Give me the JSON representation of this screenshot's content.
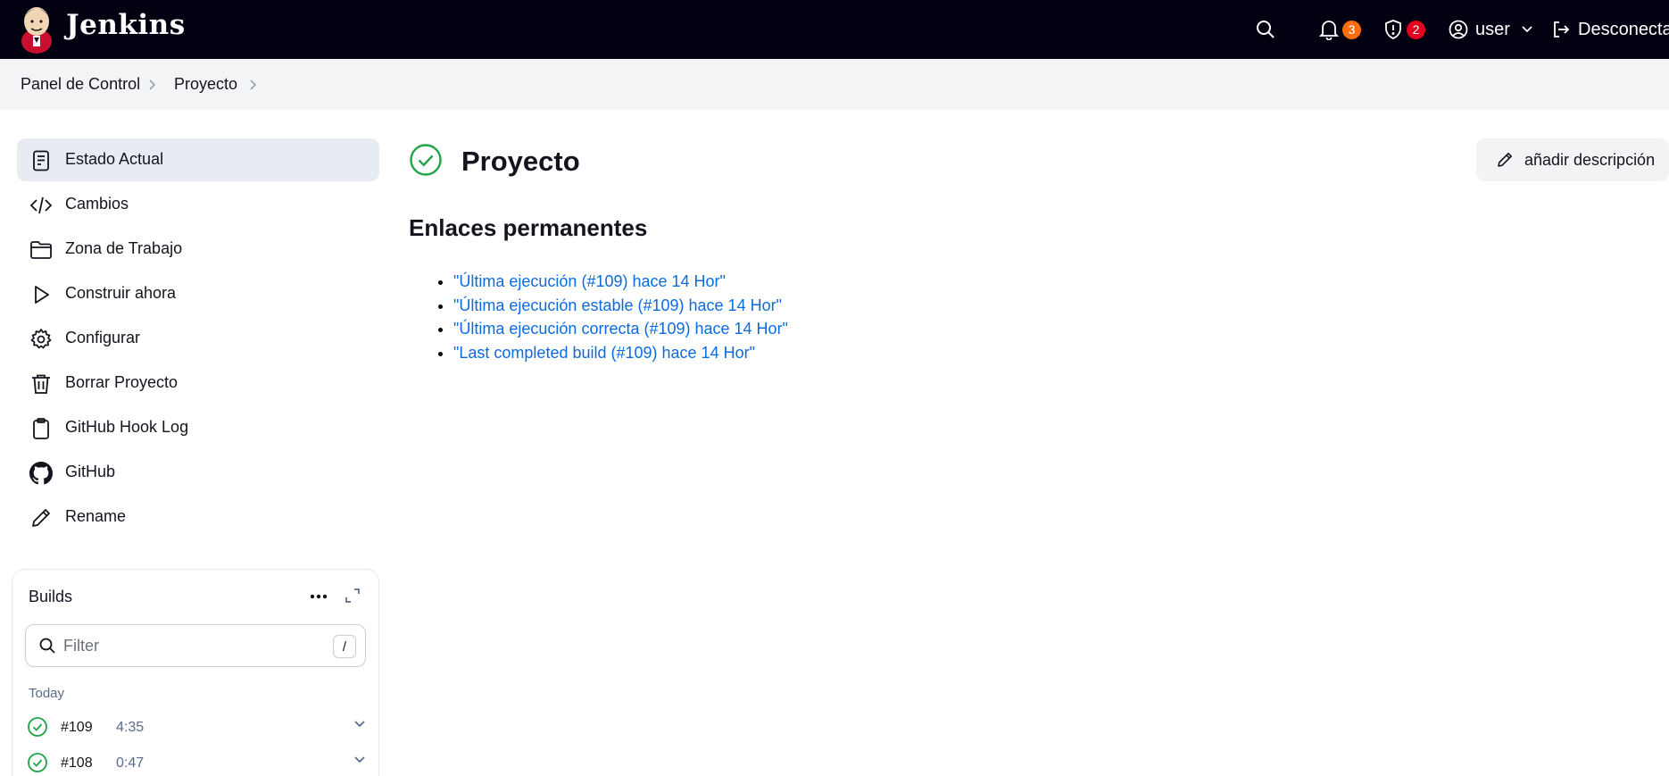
{
  "header": {
    "brand": "Jenkins",
    "notifications_count": "3",
    "security_count": "2",
    "user_label": "user",
    "logout_label": "Desconectar",
    "colors": {
      "background": "#000010",
      "notif_badge": "#fe6d0e",
      "security_badge": "#e6001f"
    }
  },
  "breadcrumb": {
    "items": [
      {
        "label": "Panel de Control"
      },
      {
        "label": "Proyecto"
      }
    ]
  },
  "sidebar": {
    "items": [
      {
        "label": "Estado Actual",
        "icon": "document-icon",
        "active": true
      },
      {
        "label": "Cambios",
        "icon": "code-icon"
      },
      {
        "label": "Zona de Trabajo",
        "icon": "folder-icon"
      },
      {
        "label": "Construir ahora",
        "icon": "play-icon"
      },
      {
        "label": "Configurar",
        "icon": "gear-icon"
      },
      {
        "label": "Borrar Proyecto",
        "icon": "trash-icon"
      },
      {
        "label": "GitHub Hook Log",
        "icon": "clipboard-icon"
      },
      {
        "label": "GitHub",
        "icon": "github-icon"
      },
      {
        "label": "Rename",
        "icon": "pencil-icon"
      }
    ]
  },
  "builds": {
    "title": "Builds",
    "filter_placeholder": "Filter",
    "filter_shortcut": "/",
    "group_label": "Today",
    "rows": [
      {
        "number": "#109",
        "time": "4:35",
        "status": "success"
      },
      {
        "number": "#108",
        "time": "0:47",
        "status": "success"
      }
    ]
  },
  "main": {
    "title": "Proyecto",
    "status": "success",
    "add_description_label": "añadir descripción",
    "permalinks_title": "Enlaces permanentes",
    "permalinks": [
      "\"Última ejecución (#109) hace 14 Hor\"",
      "\"Última ejecución estable (#109) hace 14 Hor\"",
      "\"Última ejecución correcta (#109) hace 14 Hor\"",
      "\"Last completed build (#109) hace 14 Hor\""
    ],
    "colors": {
      "link": "#0b6bde",
      "success": "#1ea446"
    }
  }
}
